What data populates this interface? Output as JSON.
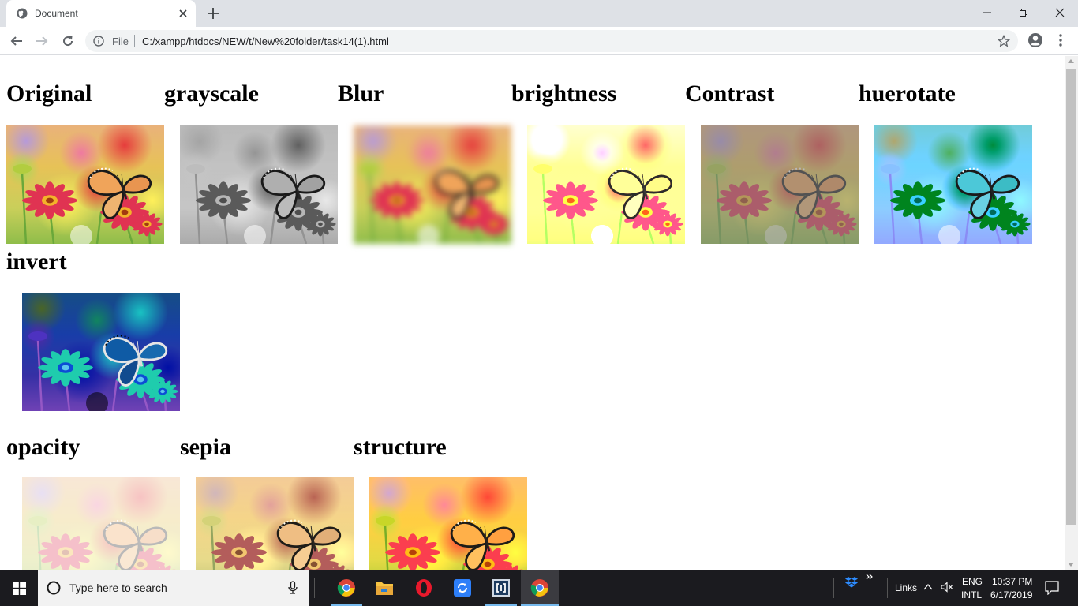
{
  "browser": {
    "tab_title": "Document",
    "scheme_label": "File",
    "url": "C:/xampp/htdocs/NEW/t/New%20folder/task14(1).html"
  },
  "page": {
    "sections": [
      {
        "caption": "Original",
        "filter": "none"
      },
      {
        "caption": "grayscale",
        "filter": "grayscale"
      },
      {
        "caption": "Blur",
        "filter": "blur"
      },
      {
        "caption": "brightness",
        "filter": "brightness"
      },
      {
        "caption": "Contrast",
        "filter": "contrast"
      },
      {
        "caption": "huerotate",
        "filter": "hue-rotate"
      },
      {
        "caption": "invert",
        "filter": "invert"
      },
      {
        "caption": "opacity",
        "filter": "opacity"
      },
      {
        "caption": "sepia",
        "filter": "sepia"
      },
      {
        "caption": "structure",
        "filter": "saturate"
      }
    ]
  },
  "taskbar": {
    "search_placeholder": "Type here to search",
    "links_label": "Links",
    "language": "ENG",
    "layout": "INTL",
    "time": "10:37 PM",
    "date": "6/17/2019",
    "apps": [
      "chrome-icon",
      "file-explorer-icon",
      "opera-icon",
      "sync-app-icon",
      "bracket-app-icon",
      "chrome-icon"
    ]
  },
  "colors": {
    "tabstrip": "#dee1e6",
    "taskbar": "#1b1b1f",
    "accent": "#76b9ed"
  }
}
